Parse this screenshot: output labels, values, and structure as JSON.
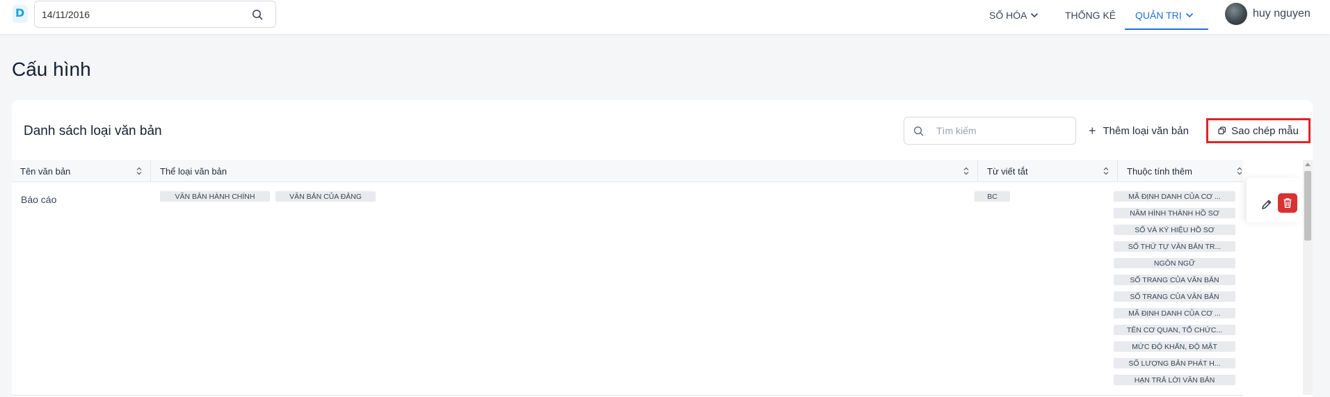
{
  "header": {
    "logo_letter": "D",
    "date_value": "14/11/2016",
    "nav": [
      {
        "label": "SỐ HÓA",
        "has_dropdown": true,
        "active": false
      },
      {
        "label": "THỐNG KÊ",
        "has_dropdown": false,
        "active": false
      },
      {
        "label": "QUẢN TRỊ",
        "has_dropdown": true,
        "active": true
      }
    ],
    "user_name": "huy nguyen",
    "accent_color": "#1d6fe0"
  },
  "page": {
    "title": "Cấu hình"
  },
  "card": {
    "title": "Danh sách loại văn bản",
    "search_placeholder": "Tìm kiếm",
    "add_button_label": "Thêm loại văn bản",
    "copy_button_label": "Sao chép mẫu",
    "highlight_color": "#e02424"
  },
  "table": {
    "columns": [
      "Tên văn bản",
      "Thể loại văn bản",
      "Từ viết tắt",
      "Thuộc tính thêm"
    ],
    "rows": [
      {
        "name": "Báo cáo",
        "categories": [
          "VĂN BẢN HÀNH CHÍNH",
          "VĂN BẢN CỦA ĐẢNG"
        ],
        "abbreviation": "BC",
        "attributes": [
          "MÃ ĐỊNH DANH CỦA CƠ ...",
          "NĂM HÌNH THÀNH HỒ SƠ",
          "SỐ VÀ KÝ HIỆU HỒ SƠ",
          "SỐ THỨ TỰ VĂN BẢN TR...",
          "NGÔN NGỮ",
          "SỐ TRANG CỦA VĂN BẢN",
          "SỐ TRANG CỦA VĂN BẢN",
          "MÃ ĐỊNH DANH CỦA CƠ ...",
          "TÊN CƠ QUAN, TỔ CHỨC...",
          "MỨC ĐỘ KHẨN, ĐỘ MẬT",
          "SỐ LƯỢNG BẢN PHÁT H...",
          "HẠN TRẢ LỜI VĂN BẢN"
        ]
      }
    ],
    "delete_color": "#d93232"
  }
}
